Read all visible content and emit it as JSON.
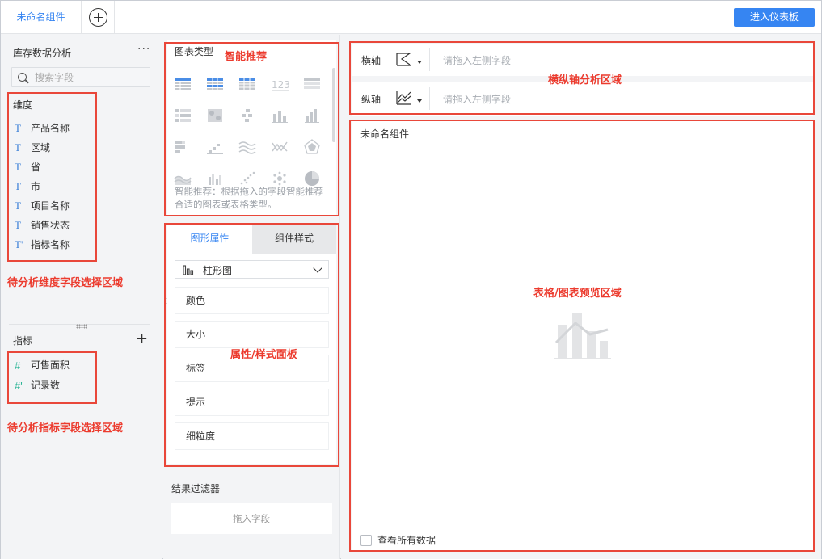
{
  "tabs": {
    "active_label": "未命名组件"
  },
  "toolbar": {
    "enter_dashboard_label": "进入仪表板"
  },
  "left": {
    "dataset_title": "库存数据分析",
    "more_label": "···",
    "search_placeholder": "搜索字段",
    "dimension_title": "维度",
    "dimensions": [
      {
        "icon": "T",
        "label": "产品名称"
      },
      {
        "icon": "T",
        "label": "区域"
      },
      {
        "icon": "T",
        "label": "省"
      },
      {
        "icon": "T",
        "label": "市"
      },
      {
        "icon": "T",
        "label": "项目名称"
      },
      {
        "icon": "T",
        "label": "销售状态"
      },
      {
        "icon": "T'",
        "label": "指标名称"
      }
    ],
    "metric_title": "指标",
    "metric_add": "+",
    "metrics": [
      {
        "icon": "#",
        "label": "可售面积"
      },
      {
        "icon": "#'",
        "label": "记录数"
      }
    ]
  },
  "middle": {
    "chart_type_title": "图表类型",
    "smart_tip": "智能推荐：根据拖入的字段智能推荐合适的图表或表格类型。",
    "chart_type_icons": [
      "grouped-table-icon",
      "detail-table-icon",
      "cross-table-icon",
      "kpi-number-icon",
      "text-table-icon",
      "heatmap-table-icon",
      "heatmap-block-icon",
      "scatter-bar-icon",
      "bar-chart-icon",
      "column-chart-icon",
      "stacked-bar-icon",
      "step-chart-icon",
      "line-chart-icon",
      "radar-line-icon",
      "radar-chart-icon",
      "area-chart-icon",
      "grouped-column-icon",
      "scatter-chart-icon",
      "bubble-chart-icon",
      "pie-chart-icon"
    ],
    "tab_graph_props": "图形属性",
    "tab_component_style": "组件样式",
    "selected_chart_type": "柱形图",
    "props": [
      "颜色",
      "大小",
      "标签",
      "提示",
      "细粒度"
    ],
    "filter_title": "结果过滤器",
    "filter_drop_label": "拖入字段"
  },
  "right": {
    "x_axis_label": "横轴",
    "y_axis_label": "纵轴",
    "x_placeholder": "请拖入左侧字段",
    "y_placeholder": "请拖入左侧字段",
    "preview_title": "未命名组件",
    "view_all_label": "查看所有数据"
  },
  "annotations": {
    "smart_recommend": "智能推荐",
    "dimension_area": "待分析维度字段选择区域",
    "metric_area": "待分析指标字段选择区域",
    "props_panel": "属性/样式面板",
    "axis_area": "横纵轴分析区域",
    "preview_area": "表格/图表预览区域"
  },
  "colors": {
    "accent": "#3685f2",
    "annotation": "#ec3b2e",
    "dimension_icon": "#3b7fd7",
    "metric_icon": "#2bb596"
  }
}
